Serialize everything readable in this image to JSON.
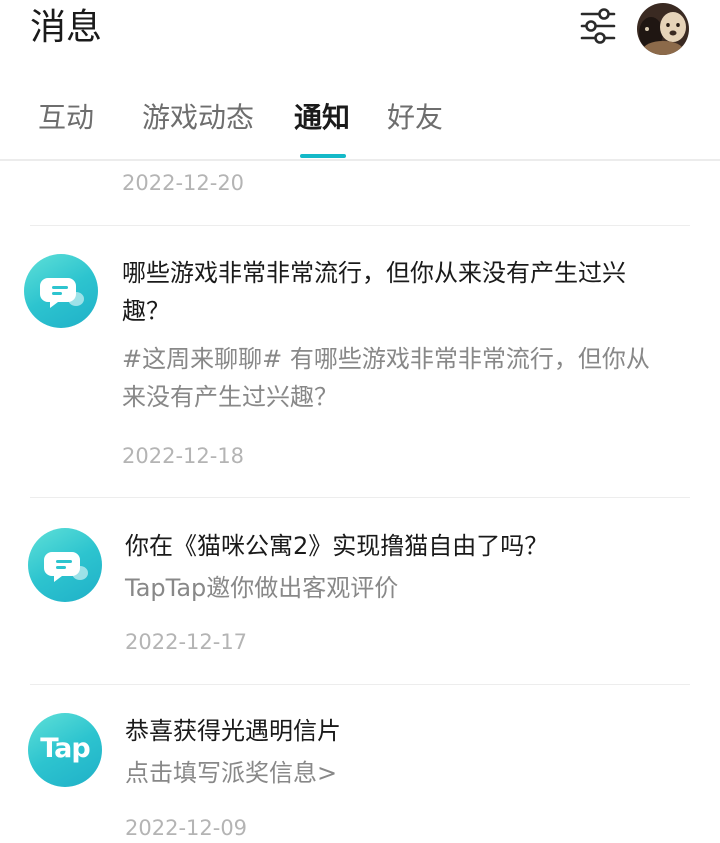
{
  "header": {
    "title": "消息",
    "filter_icon": "sliders-icon",
    "avatar_icon": "user-avatar"
  },
  "tabs": [
    {
      "label": "互动",
      "active": false
    },
    {
      "label": "游戏动态",
      "active": false
    },
    {
      "label": "通知",
      "active": true
    },
    {
      "label": "好友",
      "active": false
    }
  ],
  "colors": {
    "accent": "#14b9c8",
    "icon_gradient_start": "#5fe0d8",
    "icon_gradient_end": "#1fb0c8"
  },
  "messages": [
    {
      "date": "2022-12-20"
    },
    {
      "icon": "chat-bubble-icon",
      "title_line1": "哪些游戏非常非常流行，但你从来没有产生过兴",
      "title_line2": "趣？",
      "body_line1": "#这周来聊聊# 有哪些游戏非常非常流行，但你从",
      "body_line2": "来没有产生过兴趣？",
      "date": "2022-12-18"
    },
    {
      "icon": "chat-bubble-icon",
      "title": "你在《猫咪公寓2》实现撸猫自由了吗？",
      "body": "TapTap邀你做出客观评价",
      "date": "2022-12-17"
    },
    {
      "icon": "taptap-logo-icon",
      "logo_text": "Tap",
      "title": "恭喜获得光遇明信片",
      "body": "点击填写派奖信息>",
      "date": "2022-12-09"
    }
  ]
}
